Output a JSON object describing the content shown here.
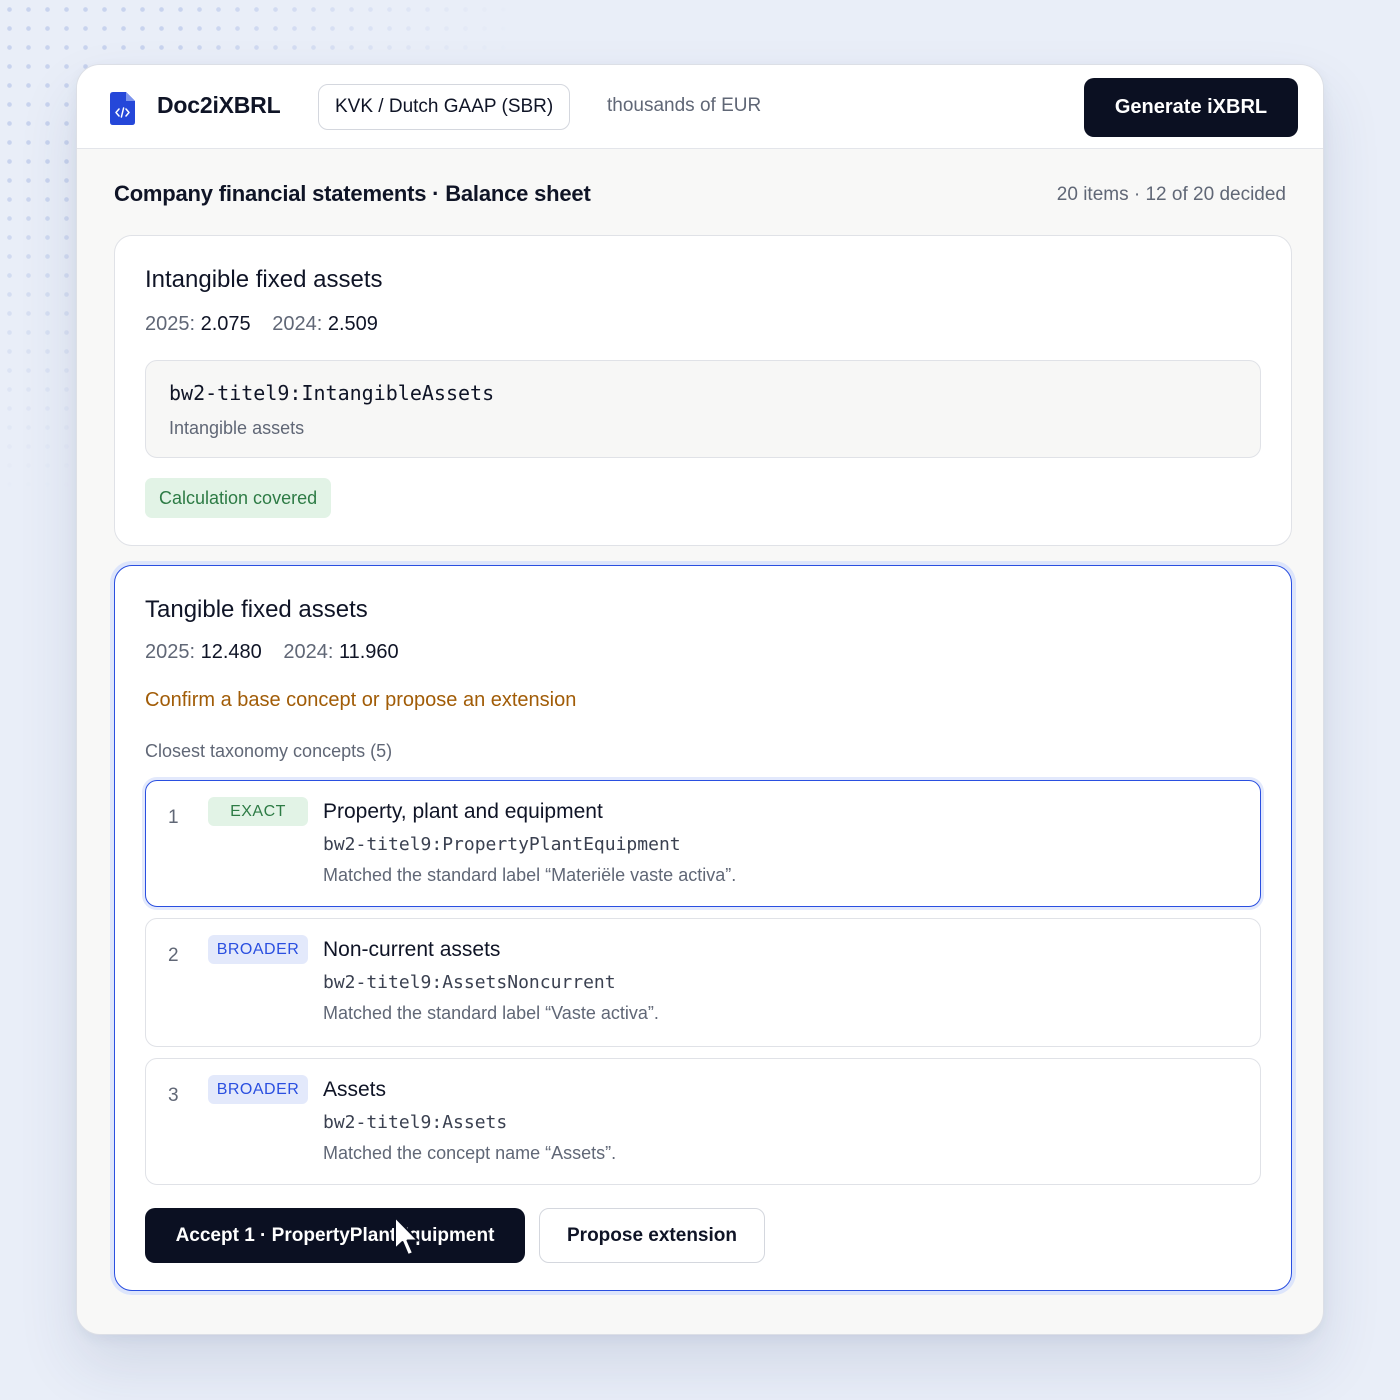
{
  "topbar": {
    "app_title": "Doc2iXBRL",
    "logo_icon": "code-file-icon",
    "taxonomy_pill": "KVK / Dutch GAAP (SBR)",
    "units": "thousands of EUR",
    "generate_label": "Generate iXBRL"
  },
  "section": {
    "title": "Company financial statements · Balance sheet",
    "meta": "20 items · 12 of 20 decided"
  },
  "item1": {
    "title": "Intangible fixed assets",
    "year1_label": "2025:",
    "year1_value": "2.075",
    "year2_label": "2024:",
    "year2_value": "2.509",
    "concept_qname": "bw2-titel9:IntangibleAssets",
    "concept_label": "Intangible assets",
    "status_badge": "Calculation covered"
  },
  "item2": {
    "title": "Tangible fixed assets",
    "year1_label": "2025:",
    "year1_value": "12.480",
    "year2_label": "2024:",
    "year2_value": "11.960",
    "prompt": "Confirm a base concept or propose an extension",
    "closest_label": "Closest taxonomy concepts (5)",
    "candidates": [
      {
        "rank": "1",
        "tag": "EXACT",
        "name": "Property, plant and equipment",
        "qname": "bw2-titel9:PropertyPlantEquipment",
        "desc": "Matched the standard label “Materiële vaste activa”."
      },
      {
        "rank": "2",
        "tag": "BROADER",
        "name": "Non-current assets",
        "qname": "bw2-titel9:AssetsNoncurrent",
        "desc": "Matched the standard label “Vaste activa”."
      },
      {
        "rank": "3",
        "tag": "BROADER",
        "name": "Assets",
        "qname": "bw2-titel9:Assets",
        "desc": "Matched the concept name “Assets”."
      }
    ],
    "accept_label": "Accept 1 · PropertyPlantEquipment",
    "propose_label": "Propose extension"
  },
  "colors": {
    "accent": "#2a4fe0",
    "dark": "#0b1022",
    "warning": "#a15c07",
    "success": "#2d7b45"
  }
}
